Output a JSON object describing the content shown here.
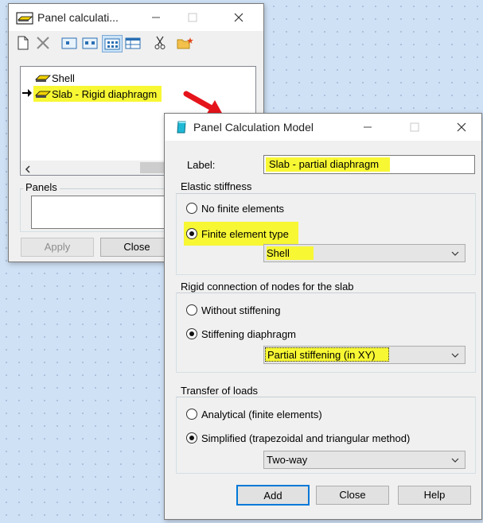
{
  "back_window": {
    "title": "Panel calculati...",
    "tree_items": [
      {
        "label": "Shell",
        "selected": false
      },
      {
        "label": "Slab - Rigid diaphragm",
        "selected": true
      }
    ],
    "panels_label": "Panels",
    "apply_label": "Apply",
    "close_label": "Close",
    "toolbar_icons": [
      "new-icon",
      "delete-icon",
      "view-panel-icon",
      "view-nodes-icon",
      "grid-view-icon",
      "table-icon",
      "cut-icon",
      "open-folder-icon"
    ]
  },
  "dialog": {
    "title": "Panel Calculation Model",
    "label_caption": "Label:",
    "label_value": "Slab - partial diaphragm",
    "elastic": {
      "title": "Elastic stiffness",
      "options": [
        "No finite elements",
        "Finite element type"
      ],
      "selected_index": 1,
      "combo_value": "Shell"
    },
    "rigid": {
      "title": "Rigid connection of nodes for the slab",
      "options": [
        "Without stiffening",
        "Stiffening diaphragm"
      ],
      "selected_index": 1,
      "combo_value": "Partial stiffening (in XY)"
    },
    "loads": {
      "title": "Transfer of loads",
      "options": [
        "Analytical (finite elements)",
        "Simplified (trapezoidal and triangular method)"
      ],
      "selected_index": 1,
      "combo_value": "Two-way"
    },
    "buttons": {
      "add": "Add",
      "close": "Close",
      "help": "Help"
    }
  },
  "colors": {
    "highlight": "#f7f734",
    "annotation_arrow": "#e5141b",
    "desktop": "#cfe1f5"
  }
}
